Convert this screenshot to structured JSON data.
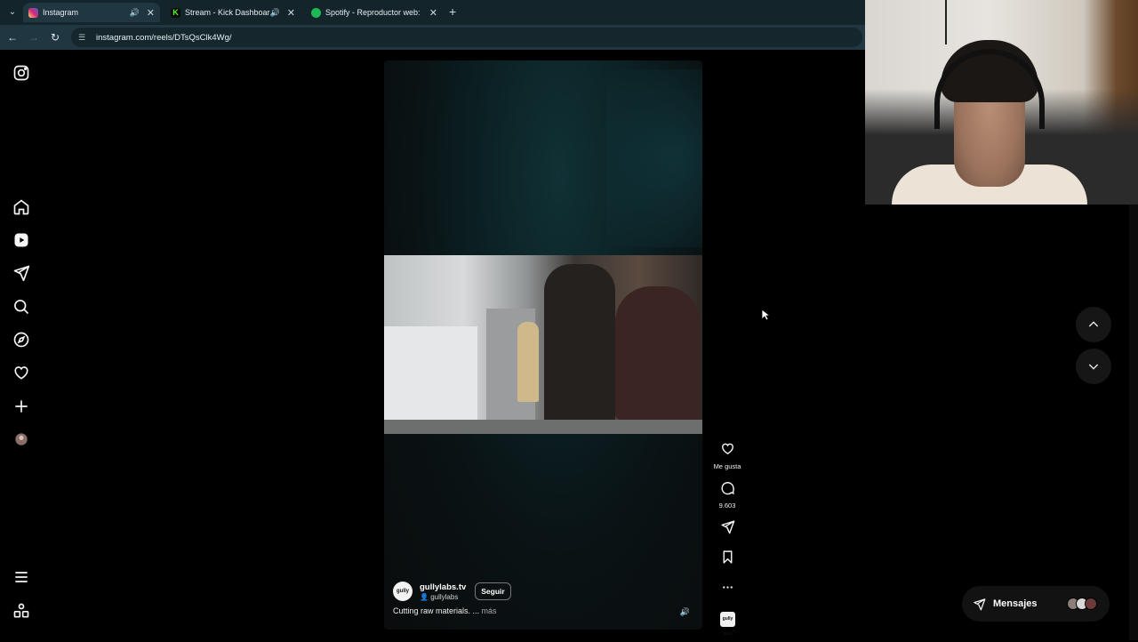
{
  "browser": {
    "tabs": [
      {
        "title": "Instagram",
        "favicon_color": "#e1306c",
        "active": true,
        "audio": true
      },
      {
        "title": "Stream - Kick Dashboard",
        "favicon_color": "#53fc18",
        "active": false,
        "audio": true
      },
      {
        "title": "Spotify - Reproductor web: mú",
        "favicon_color": "#1db954",
        "active": false,
        "audio": false
      }
    ],
    "url": "instagram.com/reels/DTsQsClk4Wg/"
  },
  "sidebar": {
    "items": [
      "instagram-logo",
      "home",
      "reels",
      "messages",
      "search",
      "explore",
      "notifications",
      "create",
      "profile",
      "more",
      "also-from-meta"
    ]
  },
  "reel": {
    "author_name": "gullylabs.tv",
    "author_sub": "gullylabs",
    "avatar_text": "gully labs",
    "follow_label": "Seguir",
    "caption": "Cutting raw materials. ...",
    "more_label": "más"
  },
  "actions": {
    "like_label": "Me gusta",
    "comments_count": "9.603"
  },
  "messages": {
    "label": "Mensajes"
  },
  "colors": {
    "background": "#000000",
    "chrome_bg": "#14242b",
    "toolbar_bg": "#203640"
  }
}
